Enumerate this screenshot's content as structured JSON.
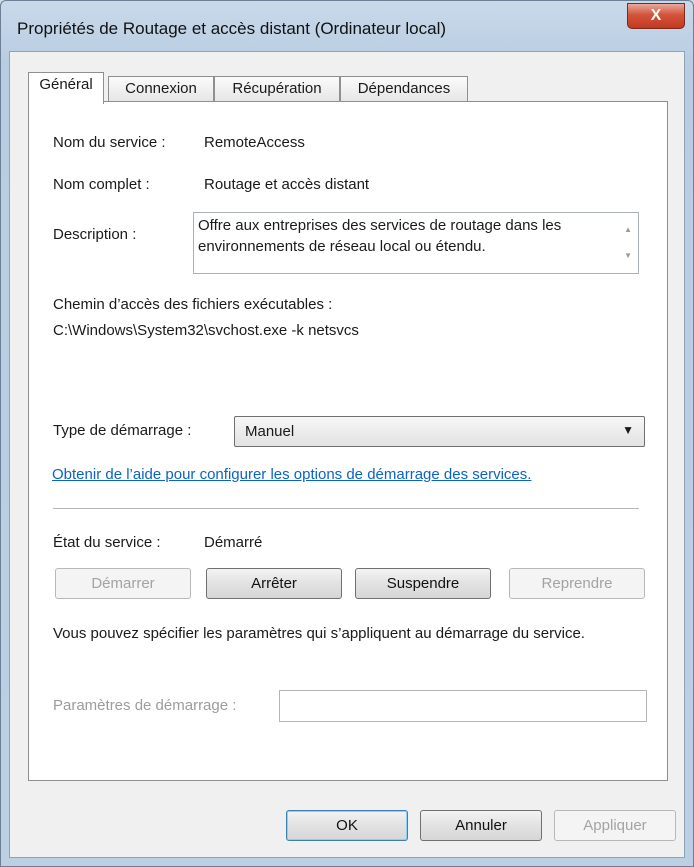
{
  "window": {
    "title": "Propriétés de Routage et accès distant (Ordinateur local)",
    "close_label": "X"
  },
  "tabs": [
    {
      "label": "Général",
      "active": true
    },
    {
      "label": "Connexion",
      "active": false
    },
    {
      "label": "Récupération",
      "active": false
    },
    {
      "label": "Dépendances",
      "active": false
    }
  ],
  "general": {
    "service_name_label": "Nom du service :",
    "service_name": "RemoteAccess",
    "display_name_label": "Nom complet :",
    "display_name": "Routage et accès distant",
    "description_label": "Description :",
    "description": "Offre aux entreprises des services de routage dans les environnements de réseau local ou étendu.",
    "exe_path_label": "Chemin d’accès des fichiers exécutables :",
    "exe_path": "C:\\Windows\\System32\\svchost.exe -k netsvcs",
    "startup_type_label": "Type de démarrage :",
    "startup_type": "Manuel",
    "help_link": "Obtenir de l’aide pour configurer les options de démarrage des services.",
    "status_label": "État du service :",
    "status": "Démarré",
    "buttons": {
      "start": "Démarrer",
      "stop": "Arrêter",
      "pause": "Suspendre",
      "resume": "Reprendre"
    },
    "params_hint": "Vous pouvez spécifier les paramètres qui s’appliquent au démarrage du service.",
    "params_label": "Paramètres de démarrage :",
    "params_value": ""
  },
  "footer": {
    "ok": "OK",
    "cancel": "Annuler",
    "apply": "Appliquer"
  }
}
